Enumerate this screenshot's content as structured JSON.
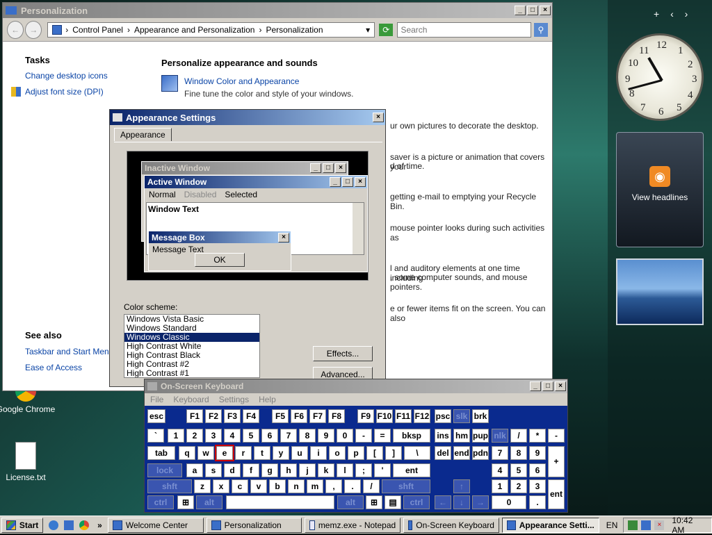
{
  "desktop": {
    "icons": [
      {
        "label": "Google Chrome"
      },
      {
        "label": "License.txt"
      }
    ],
    "sidebar": {
      "add": "+",
      "prev": "‹",
      "next": "›"
    },
    "clock_numbers": [
      "12",
      "1",
      "2",
      "3",
      "4",
      "5",
      "6",
      "7",
      "8",
      "9",
      "10",
      "11"
    ],
    "feed_label": "View headlines"
  },
  "personalization": {
    "title": "Personalization",
    "breadcrumb": [
      "Control Panel",
      "Appearance and Personalization",
      "Personalization"
    ],
    "search_placeholder": "Search",
    "tasks_heading": "Tasks",
    "tasks": [
      "Change desktop icons",
      "Adjust font size (DPI)"
    ],
    "main_heading": "Personalize appearance and sounds",
    "item_link": "Window Color and Appearance",
    "item_desc": "Fine tune the color and style of your windows.",
    "partial_lines": [
      "ur own pictures to decorate the desktop.",
      "saver is a picture or animation that covers your",
      "d of time.",
      "getting e-mail to emptying your Recycle Bin.",
      "mouse pointer looks during such activities as",
      "l and auditory elements at one time including",
      ", some computer sounds, and mouse pointers.",
      "e or fewer items fit on the screen. You can also"
    ],
    "see_also_heading": "See also",
    "see_also": [
      "Taskbar and Start Menu",
      "Ease of Access"
    ]
  },
  "appearance": {
    "title": "Appearance Settings",
    "tab": "Appearance",
    "preview": {
      "inactive_title": "Inactive Window",
      "active_title": "Active Window",
      "menu": [
        "Normal",
        "Disabled",
        "Selected"
      ],
      "window_text": "Window Text",
      "msgbox_title": "Message Box",
      "msgbox_text": "Message Text",
      "ok": "OK"
    },
    "scheme_label": "Color scheme:",
    "schemes": [
      "Windows Vista Basic",
      "Windows Standard",
      "Windows Classic",
      "High Contrast White",
      "High Contrast Black",
      "High Contrast #2",
      "High Contrast #1"
    ],
    "selected_scheme": "Windows Classic",
    "effects": "Effects...",
    "advanced": "Advanced..."
  },
  "osk": {
    "title": "On-Screen Keyboard",
    "menu": [
      "File",
      "Keyboard",
      "Settings",
      "Help"
    ]
  },
  "taskbar": {
    "start": "Start",
    "buttons": [
      "Welcome Center",
      "Personalization",
      "memz.exe - Notepad",
      "On-Screen Keyboard",
      "Appearance Setti..."
    ],
    "lang": "EN",
    "time": "10:42 AM"
  }
}
